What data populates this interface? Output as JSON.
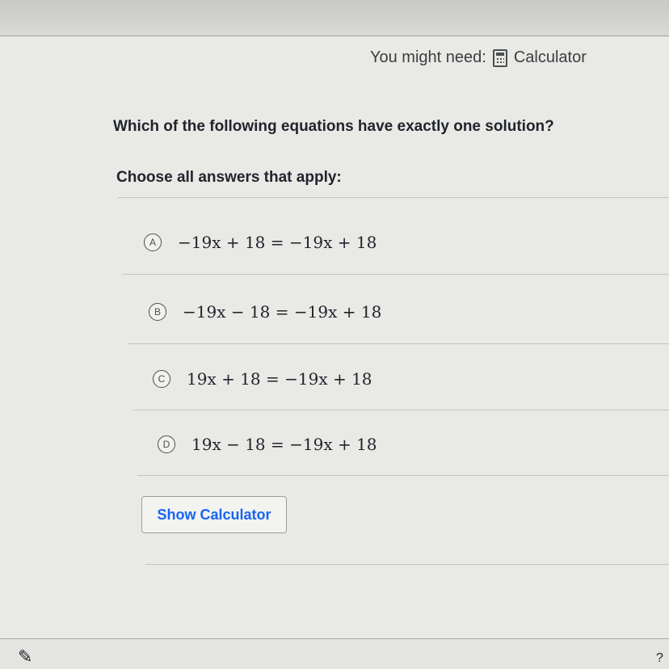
{
  "hint": {
    "prefix": "You might need:",
    "tool_label": "Calculator",
    "tool_icon": "calculator-icon"
  },
  "question": {
    "prompt": "Which of the following equations have exactly one solution?",
    "instruction": "Choose all answers that apply:"
  },
  "choices": [
    {
      "letter": "A",
      "equation": "−19x + 18 = −19x + 18",
      "selected": false
    },
    {
      "letter": "B",
      "equation": "−19x − 18 = −19x + 18",
      "selected": false
    },
    {
      "letter": "C",
      "equation": "19x + 18 = −19x + 18",
      "selected": false
    },
    {
      "letter": "D",
      "equation": "19x − 18 = −19x + 18",
      "selected": false
    }
  ],
  "actions": {
    "show_calculator_label": "Show Calculator"
  },
  "footer": {
    "tool_icon": "pencil-icon",
    "corner_text": "?"
  },
  "colors": {
    "link_blue": "#1865f2",
    "text": "#21242c",
    "divider": "#c2c4c6"
  }
}
